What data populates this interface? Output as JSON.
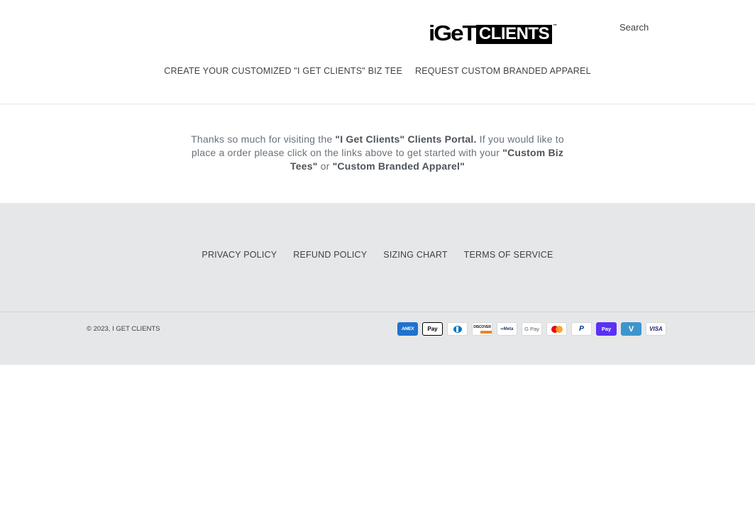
{
  "header": {
    "logo": {
      "part1": "iGeT",
      "part2": "CLIENTS",
      "tm": "™"
    },
    "search_label": "Search",
    "nav": [
      {
        "label": "CREATE YOUR CUSTOMIZED \"I GET CLIENTS\" BIZ TEE"
      },
      {
        "label": "REQUEST CUSTOM BRANDED APPAREL"
      }
    ]
  },
  "main": {
    "intro": {
      "t1": "Thanks so much for visiting the ",
      "b1": "\"I Get Clients\" Clients Portal.",
      "t2": " If you would like to place a order please click on the links above to get started with your ",
      "b2": "\"Custom Biz Tees\"",
      "t3": " or ",
      "b3": "\"Custom Branded Apparel\""
    }
  },
  "footer": {
    "links": [
      {
        "label": "PRIVACY POLICY"
      },
      {
        "label": "REFUND POLICY"
      },
      {
        "label": "SIZING CHART"
      },
      {
        "label": "TERMS OF SERVICE"
      }
    ],
    "copyright_prefix": "© 2023, ",
    "copyright_link": "I GET CLIENTS",
    "payments": [
      {
        "name": "American Express",
        "label": "AMEX"
      },
      {
        "name": "Apple Pay",
        "label": " Pay"
      },
      {
        "name": "Diners Club",
        "label": ""
      },
      {
        "name": "Discover",
        "label": "DISCOVER"
      },
      {
        "name": "Meta Pay",
        "label": "∞Meta"
      },
      {
        "name": "Google Pay",
        "label": "G Pay"
      },
      {
        "name": "Mastercard",
        "label": ""
      },
      {
        "name": "PayPal",
        "label": "P"
      },
      {
        "name": "Shop Pay",
        "label": "Pay"
      },
      {
        "name": "Venmo",
        "label": "V"
      },
      {
        "name": "Visa",
        "label": "VISA"
      }
    ]
  }
}
